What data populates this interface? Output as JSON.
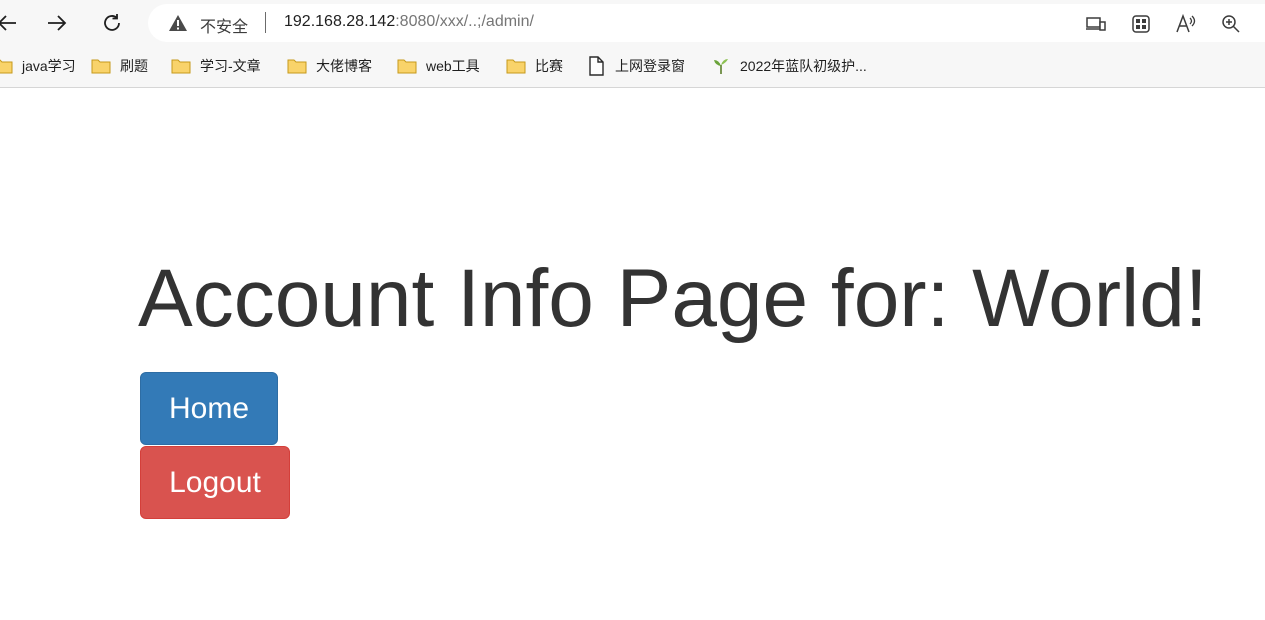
{
  "browser": {
    "security_label": "不安全",
    "url_host": "192.168.28.142",
    "url_rest": ":8080/xxx/..;/admin/"
  },
  "bookmarks": [
    {
      "label": "java学习",
      "icon": "folder-icon"
    },
    {
      "label": "刷题",
      "icon": "folder-icon"
    },
    {
      "label": "学习-文章",
      "icon": "folder-icon"
    },
    {
      "label": "大佬博客",
      "icon": "folder-icon"
    },
    {
      "label": "web工具",
      "icon": "folder-icon"
    },
    {
      "label": "比赛",
      "icon": "folder-icon"
    },
    {
      "label": "上网登录窗",
      "icon": "page-icon"
    },
    {
      "label": "2022年蓝队初级护...",
      "icon": "sprout-icon"
    }
  ],
  "page": {
    "title": "Account Info Page for: World!",
    "home_label": "Home",
    "logout_label": "Logout"
  },
  "colors": {
    "home_button": "#337ab7",
    "logout_button": "#d9534f",
    "title_text": "#333333"
  }
}
